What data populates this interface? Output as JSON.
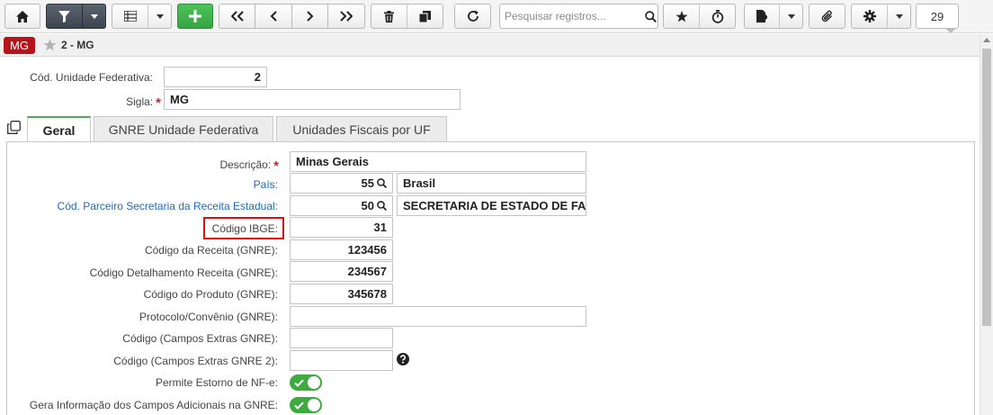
{
  "toolbar": {
    "buttons": [
      {
        "icon": "home-icon"
      },
      {
        "icon": "filter-icon"
      },
      {
        "icon": "list-icon"
      },
      {
        "icon": "plus-icon"
      },
      {
        "icon": "first-icon"
      },
      {
        "icon": "previous-icon"
      },
      {
        "icon": "next-icon"
      },
      {
        "icon": "last-icon"
      },
      {
        "icon": "trash-icon"
      },
      {
        "icon": "copy-icon"
      },
      {
        "icon": "refresh-icon"
      },
      {
        "icon": "star-icon"
      },
      {
        "icon": "stopwatch-icon"
      },
      {
        "icon": "report-icon"
      },
      {
        "icon": "paperclip-icon"
      },
      {
        "icon": "gear-icon"
      }
    ],
    "search_placeholder": "Pesquisar registros...",
    "counter": "29"
  },
  "record": {
    "badge": "MG",
    "title": "2 - MG"
  },
  "header_fields": {
    "cod_label": "Cód. Unidade Federativa:",
    "cod_value": "2",
    "sigla_label": "Sigla:",
    "sigla_value": "MG"
  },
  "tabs": [
    {
      "label": "Geral",
      "active": true
    },
    {
      "label": "GNRE Unidade Federativa",
      "active": false
    },
    {
      "label": "Unidades Fiscais por UF",
      "active": false
    }
  ],
  "geral": {
    "descricao_label": "Descrição:",
    "descricao_value": "Minas Gerais",
    "pais_label": "País:",
    "pais_code": "55",
    "pais_name": "Brasil",
    "parceiro_label": "Cód. Parceiro Secretaria da Receita Estadual:",
    "parceiro_code": "50",
    "parceiro_name": "SECRETARIA DE ESTADO DE FA",
    "ibge_label": "Código IBGE:",
    "ibge_value": "31",
    "receita_label": "Código da Receita (GNRE):",
    "receita_value": "123456",
    "detalhamento_label": "Código Detalhamento Receita (GNRE):",
    "detalhamento_value": "234567",
    "produto_label": "Código do Produto (GNRE):",
    "produto_value": "345678",
    "protocolo_label": "Protocolo/Convênio (GNRE):",
    "protocolo_value": "",
    "extras_label": "Código (Campos Extras GNRE):",
    "extras_value": "",
    "extras2_label": "Código (Campos Extras GNRE 2):",
    "extras2_value": "",
    "estorno_label": "Permite Estorno de NF-e:",
    "estorno_on": true,
    "gera_info_label": "Gera Informação dos Campos Adicionais na GNRE:",
    "gera_info_on": true
  },
  "colors": {
    "accent_green": "#3faa3f",
    "badge_red": "#b8131b",
    "link_blue": "#1a6bc7",
    "highlight_red": "#e01010"
  }
}
